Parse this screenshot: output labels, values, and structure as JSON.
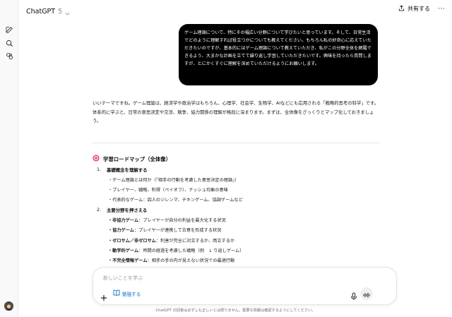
{
  "header": {
    "model_name": "ChatGPT",
    "model_version": "5",
    "share_label": "共有する"
  },
  "user_message": "ゲーム理論について、特にその幅広い分野について学びたいと思っています。そして、日常生活でどのように理解すれば役立つかについても教えてください。もちろん私の好奇心に応えていただきたいのですが、基本的にはゲーム理論について教えていただき、私がこの分野全体を網羅できるよう、大まかな計画を立てて繰り返し学習していただきたいです。興味を持ったら質問しますが、とにかくすぐに理解を深めていただけるようにお願いします。",
  "assistant": {
    "intro": "いいテーマですね。ゲーム理論は、経済学や政治学はもちろん、心理学、社会学、生物学、AIなどにも応用される「戦略的思考の科学」です。体系的に学ぶと、日常の意思決定や交渉、競争、協力関係の理解が格段に深まります。まずは、全体像をざっくりとマップ化しておきましょう。",
    "roadmap_title": "学習ロードマップ（全体像）",
    "sections": [
      {
        "num": "1.",
        "title": "基礎概念を理解する",
        "items": [
          {
            "bold": "",
            "text": "・ゲーム理論とは何か（「相手の行動を考慮した意思決定の理論」）"
          },
          {
            "bold": "",
            "text": "・プレイヤー、戦略、利得（ペイオフ）、ナッシュ均衡の意味"
          },
          {
            "bold": "",
            "text": "・代表的なゲーム：囚人のジレンマ、チキンゲーム、協調ゲームなど"
          }
        ]
      },
      {
        "num": "2.",
        "title": "主要分野を押さえる",
        "items": [
          {
            "bold": "・非協力ゲーム",
            "text": "：プレイヤーが自分の利益を最大化する状況"
          },
          {
            "bold": "・協力ゲーム",
            "text": "：プレイヤーが連携して合意を形成する状況"
          },
          {
            "bold": "・ゼロサム／非ゼロサム",
            "text": "：利害が完全に対立するか、両立するか"
          },
          {
            "bold": "・動学的ゲーム",
            "text": "：時間の経過を考慮した戦略（例　↓ り返しゲーム）"
          },
          {
            "bold": "・不完全情報ゲーム",
            "text": "：相手の手の内が見えない状況での最適行動"
          }
        ]
      }
    ]
  },
  "composer": {
    "placeholder": "新しいことを学ぶ",
    "study_label": "勉強する"
  },
  "footer_note": "ChatGPT の回答は必ずしも正しいとは限りません。重要な情報は確認するようにしてください。",
  "icons": [
    "new-chat-icon",
    "search-icon",
    "library-icon",
    "chevron-down-icon",
    "share-icon",
    "more-icon",
    "target-icon",
    "plus-icon",
    "book-icon",
    "mic-icon",
    "voice-icon"
  ],
  "colors": {
    "user_bubble": "#000000",
    "study_accent": "#0b6bcb",
    "sidebar": "#f9f9f9"
  }
}
